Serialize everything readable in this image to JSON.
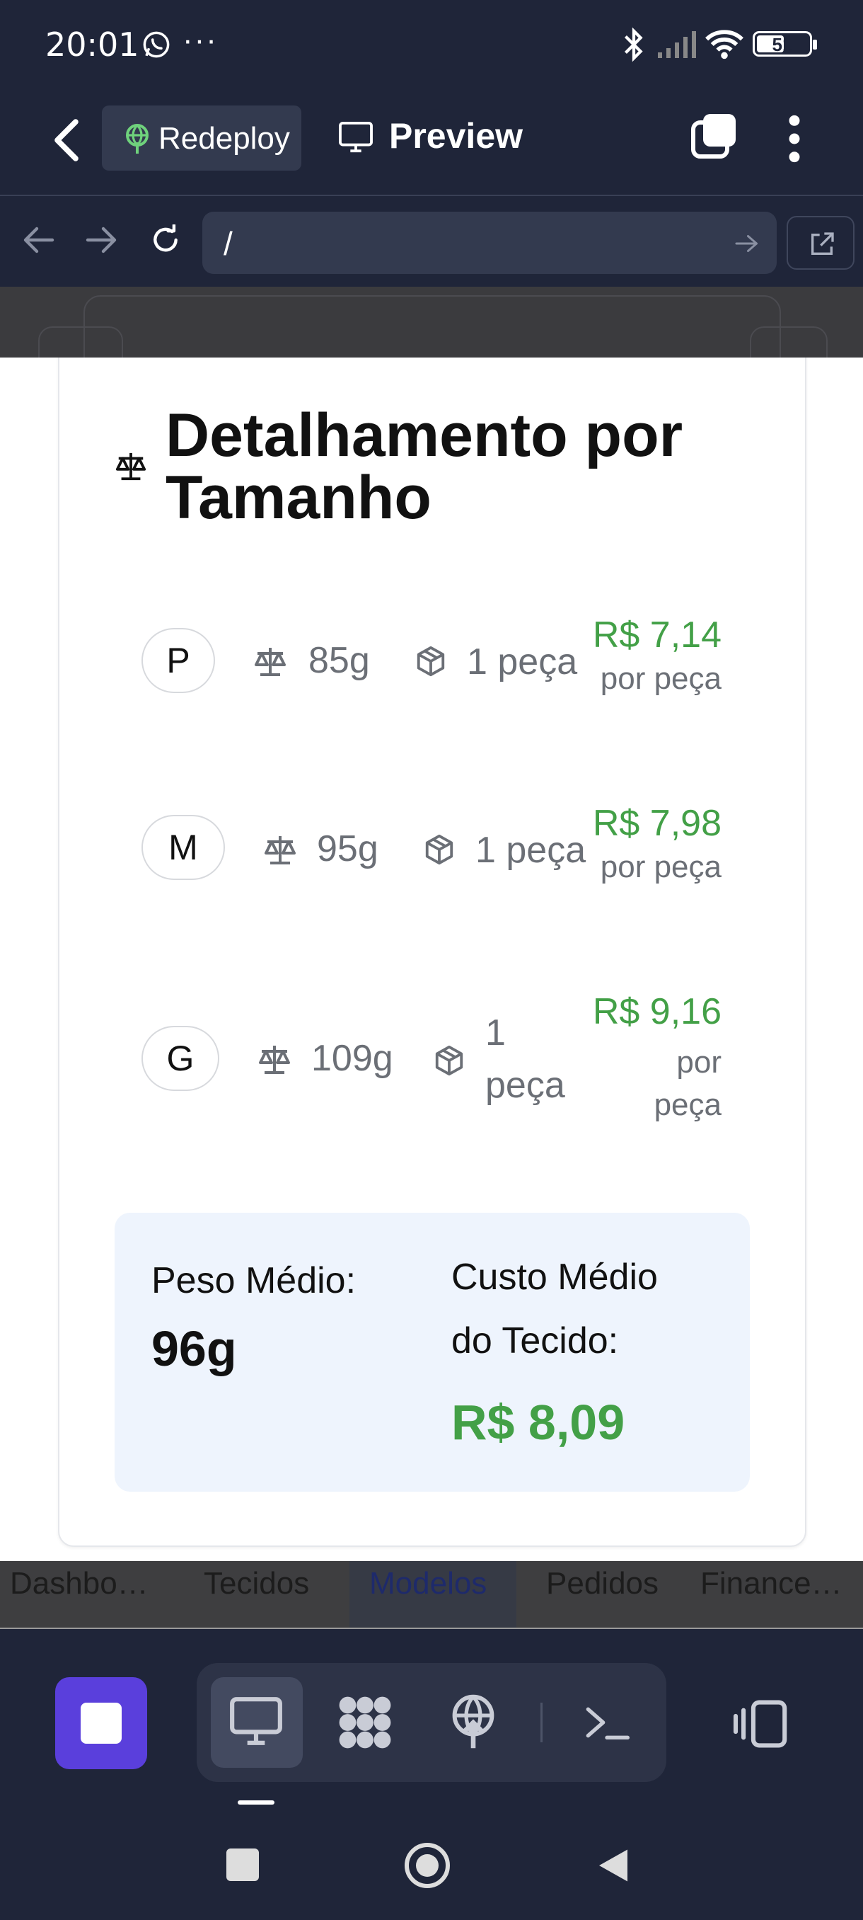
{
  "status_bar": {
    "time": "20:01",
    "more_dots": "···",
    "battery_level": "51"
  },
  "app_header": {
    "redeploy_label": "Redeploy",
    "preview_label": "Preview"
  },
  "url_bar": {
    "path": "/"
  },
  "card": {
    "title": "Detalhamento por Tamanho",
    "rows": [
      {
        "size": "P",
        "weight": "85g",
        "pieces": "1 peça",
        "price": "R$ 7,14",
        "per": "por peça"
      },
      {
        "size": "M",
        "weight": "95g",
        "pieces": "1 peça",
        "price": "R$ 7,98",
        "per": "por peça"
      },
      {
        "size": "G",
        "weight": "109g",
        "pieces_line1": "1",
        "pieces_line2": "peça",
        "price": "R$ 9,16",
        "per_line1": "por",
        "per_line2": "peça"
      }
    ],
    "summary": {
      "avg_weight_label": "Peso Médio:",
      "avg_weight_value": "96g",
      "avg_cost_label": "Custo Médio do Tecido:",
      "avg_cost_value": "R$ 8,09"
    }
  },
  "web_tabs": [
    {
      "label": "Dashbo…",
      "active": false
    },
    {
      "label": "Tecidos",
      "active": false
    },
    {
      "label": "Modelos",
      "active": true
    },
    {
      "label": "Pedidos",
      "active": false
    },
    {
      "label": "Finance…",
      "active": false
    }
  ],
  "colors": {
    "accent_green": "#43a047",
    "stop_button": "#5a3fdc",
    "app_background": "#1f2539",
    "summary_background": "#eef4fd"
  }
}
